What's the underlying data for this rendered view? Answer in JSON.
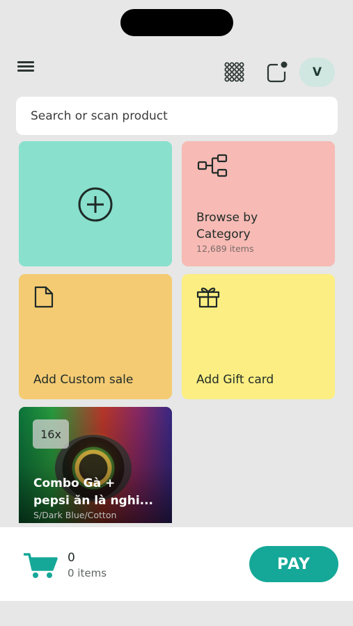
{
  "header": {
    "avatar_initial": "V"
  },
  "search": {
    "placeholder": "Search or scan product"
  },
  "tiles": {
    "browse": {
      "title_line1": "Browse by",
      "title_line2": "Category",
      "count": "12,689 items"
    },
    "custom": {
      "title": "Add Custom sale"
    },
    "gift": {
      "title": "Add Gift card"
    }
  },
  "product": {
    "badge": "16x",
    "name_line1": "Combo Gà +",
    "name_line2": "pepsi ăn là nghi...",
    "variant": "S/Dark Blue/Cotton"
  },
  "cart": {
    "count": "0",
    "items_label": "0 items",
    "pay_label": "PAY"
  },
  "colors": {
    "accent": "#15a898",
    "tile_add": "#88e0cd",
    "tile_browse": "#f7bab4",
    "tile_custom": "#f4cb73",
    "tile_gift": "#fcee82"
  },
  "icons": [
    "menu-icon",
    "apps-grid-icon",
    "notification-icon",
    "add-circle-icon",
    "category-tree-icon",
    "document-icon",
    "gift-icon",
    "cart-icon"
  ]
}
